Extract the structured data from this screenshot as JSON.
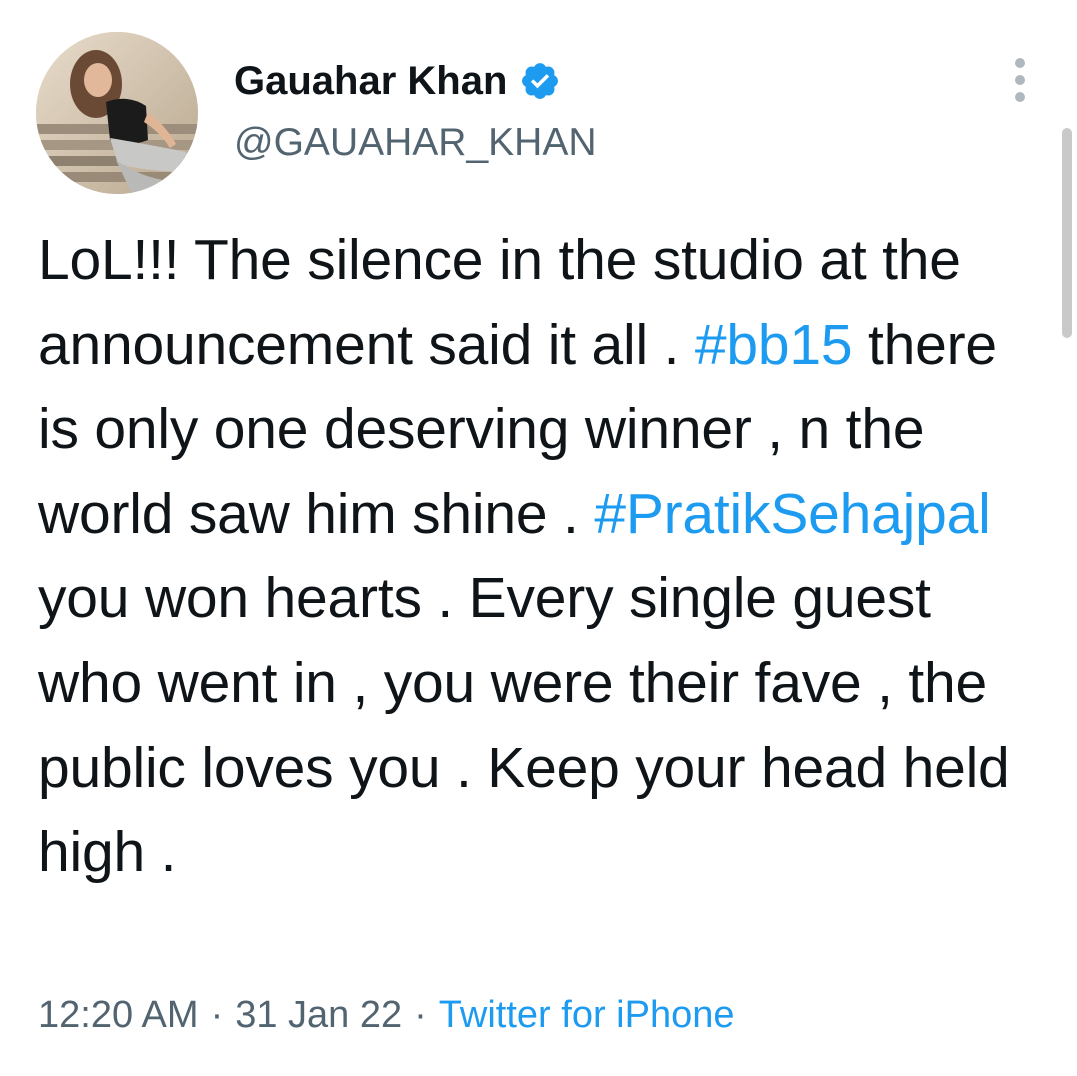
{
  "user": {
    "display_name": "Gauahar Khan",
    "handle": "@GAUAHAR_KHAN",
    "verified_icon": "verified-badge-icon",
    "avatar": "profile-photo"
  },
  "menu": {
    "icon": "more-vertical-icon"
  },
  "tweet": {
    "segments": [
      {
        "type": "text",
        "text": "LoL!!! The silence in the studio at the announcement said it all . "
      },
      {
        "type": "hashtag",
        "text": "#bb15"
      },
      {
        "type": "text",
        "text": " there is only one deserving winner , n the world saw him shine . "
      },
      {
        "type": "hashtag",
        "text": "#PratikSehajpal"
      },
      {
        "type": "text",
        "text": " you won hearts . Every single guest who went in , you were their fave , the public loves you . Keep your head held high ."
      }
    ]
  },
  "meta": {
    "time": "12:20 AM",
    "separator": "·",
    "date": "31 Jan 22",
    "source": "Twitter for iPhone"
  },
  "colors": {
    "text": "#0f1419",
    "secondary": "#536471",
    "link": "#1d9bf0",
    "verified": "#1d9bf0"
  }
}
